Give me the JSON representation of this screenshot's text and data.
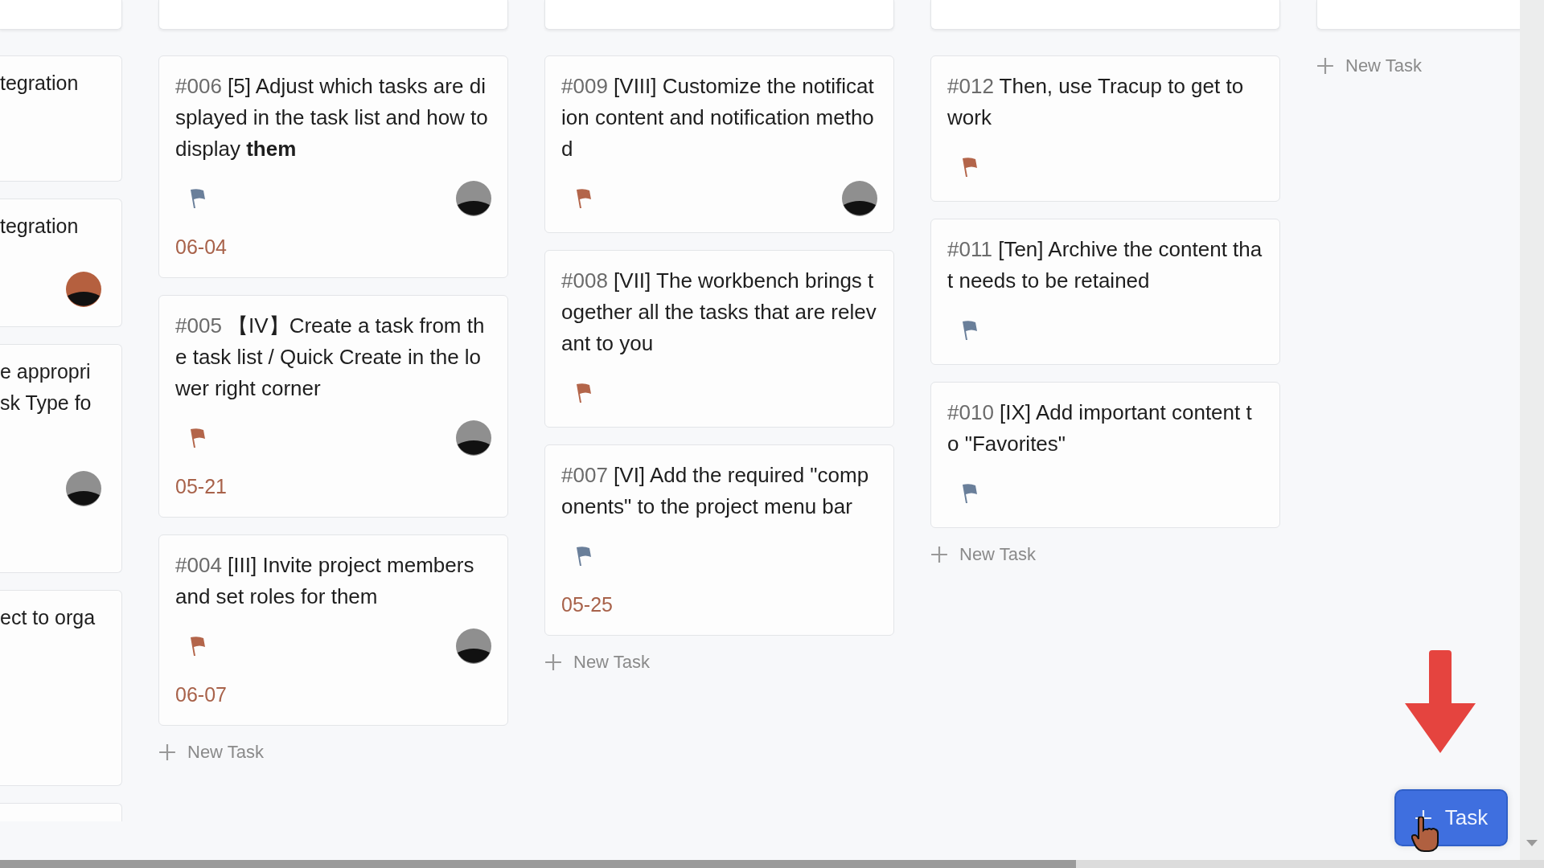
{
  "left_column": {
    "cards": [
      {
        "kind": "card",
        "text": "tegration"
      },
      {
        "kind": "card",
        "text": "tegration",
        "avatar": {
          "color": "#b5603f"
        }
      },
      {
        "kind": "card",
        "text": "e appropri\nsk Type fo",
        "avatar": {
          "color": "#8f8f8f"
        }
      },
      {
        "kind": "card",
        "text": "ect to orga"
      },
      {
        "kind": "card"
      }
    ]
  },
  "columns": [
    {
      "cards": [
        {
          "number": "#006",
          "title": "[5] Adjust which tasks are displayed in the task list and how to display **them**",
          "flag": {
            "color": "#6a7f9a"
          },
          "avatar": {
            "color": "#8f8f8f"
          },
          "due": "06-04"
        },
        {
          "number": "#005",
          "title": "【IV】Create a task from the task list / Quick Create in the lower right corner",
          "flag": {
            "color": "#b3654a"
          },
          "avatar": {
            "color": "#8f8f8f"
          },
          "due": "05-21"
        },
        {
          "number": "#004",
          "title": "[III] Invite project members and set roles for them",
          "flag": {
            "color": "#b3654a"
          },
          "avatar": {
            "color": "#8f8f8f"
          },
          "due": "06-07"
        }
      ],
      "new_task_label": "New Task"
    },
    {
      "cards": [
        {
          "number": "#009",
          "title": "[VIII] Customize the notification content and notification method",
          "flag": {
            "color": "#b3654a"
          },
          "avatar": {
            "color": "#8f8f8f"
          }
        },
        {
          "number": "#008",
          "title": "[VII] The workbench brings together all the tasks that are relevant to you",
          "flag": {
            "color": "#b3654a"
          }
        },
        {
          "number": "#007",
          "title": "[VI] Add the required \"components\" to the project menu bar",
          "flag": {
            "color": "#6a7f9a"
          },
          "due": "05-25"
        }
      ],
      "new_task_label": "New Task"
    },
    {
      "cards": [
        {
          "number": "#012",
          "title": "Then, use Tracup to get to work",
          "flag": {
            "color": "#b3654a"
          }
        },
        {
          "number": "#011",
          "title": "[Ten] Archive the content that needs to be retained",
          "flag": {
            "color": "#6a7f9a"
          }
        },
        {
          "number": "#010",
          "title": "[IX] Add important content to \"Favorites\"",
          "flag": {
            "color": "#6a7f9a"
          }
        }
      ],
      "new_task_label": "New Task"
    },
    {
      "new_task_label": "New Task"
    }
  ],
  "add_button": {
    "label": "Task"
  }
}
